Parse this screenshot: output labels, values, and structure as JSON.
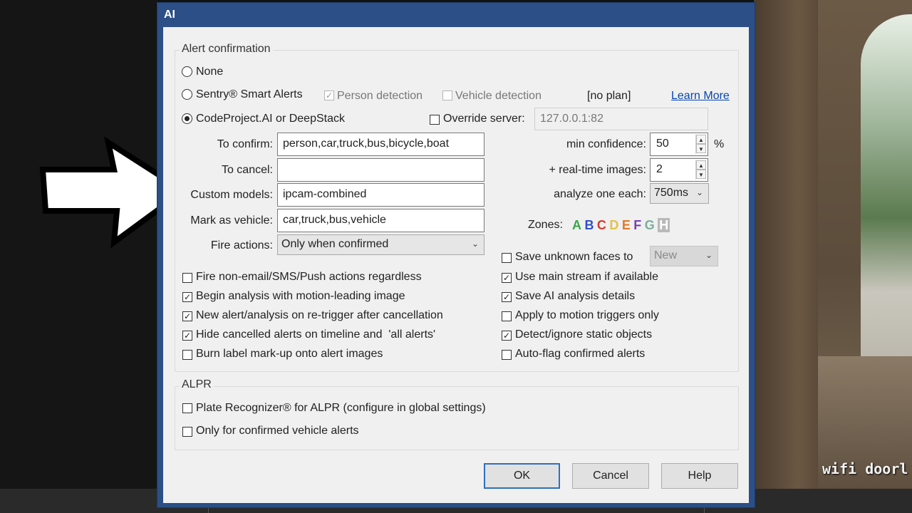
{
  "dialog": {
    "title": "AI"
  },
  "background": {
    "overlay_text": "wifi doorl"
  },
  "alert_confirmation": {
    "group_label": "Alert confirmation",
    "radio_none": "None",
    "radio_sentry": "Sentry® Smart Alerts",
    "person_detection": "Person detection",
    "vehicle_detection": "Vehicle detection",
    "no_plan": "[no plan]",
    "learn_more": "Learn More",
    "radio_codeproject": "CodeProject.AI or DeepStack",
    "override_server_label": "Override server:",
    "override_server_value": "127.0.0.1:82",
    "to_confirm_label": "To confirm:",
    "to_confirm_value": "person,car,truck,bus,bicycle,boat",
    "to_cancel_label": "To cancel:",
    "to_cancel_value": "",
    "custom_models_label": "Custom models:",
    "custom_models_value": "ipcam-combined",
    "mark_vehicle_label": "Mark as vehicle:",
    "mark_vehicle_value": "car,truck,bus,vehicle",
    "fire_actions_label": "Fire actions:",
    "fire_actions_value": "Only when confirmed",
    "min_confidence_label": "min confidence:",
    "min_confidence_value": "50",
    "percent": "%",
    "realtime_images_label": "+ real-time images:",
    "realtime_images_value": "2",
    "analyze_each_label": "analyze one each:",
    "analyze_each_value": "750ms",
    "zones_label": "Zones:",
    "zones": [
      {
        "letter": "A",
        "color": "#3aa845"
      },
      {
        "letter": "B",
        "color": "#2f4fc6"
      },
      {
        "letter": "C",
        "color": "#d43b2f"
      },
      {
        "letter": "D",
        "color": "#e2c24a"
      },
      {
        "letter": "E",
        "color": "#e07a2a"
      },
      {
        "letter": "F",
        "color": "#7a3fb0"
      },
      {
        "letter": "G",
        "color": "#7cae9c"
      },
      {
        "letter": "H",
        "color": "#b9b9b9"
      }
    ],
    "save_unknown_faces_label": "Save unknown faces to",
    "save_unknown_faces_value": "New",
    "left_checks": [
      {
        "label": "Fire non-email/SMS/Push actions regardless",
        "checked": false
      },
      {
        "label": "Begin analysis with motion-leading image",
        "checked": true
      },
      {
        "label": "New alert/analysis on re-trigger after cancellation",
        "checked": true
      },
      {
        "label": "Hide cancelled alerts on timeline and  'all alerts'",
        "checked": true
      },
      {
        "label": "Burn label mark-up onto alert images",
        "checked": false
      }
    ],
    "right_checks": [
      {
        "label": "Use main stream if available",
        "checked": true
      },
      {
        "label": "Save AI analysis details",
        "checked": true
      },
      {
        "label": "Apply to motion triggers only",
        "checked": false
      },
      {
        "label": "Detect/ignore static objects",
        "checked": true
      },
      {
        "label": "Auto-flag confirmed alerts",
        "checked": false
      }
    ],
    "check_mark": "✓"
  },
  "alpr": {
    "group_label": "ALPR",
    "plate_recognizer": "Plate Recognizer® for ALPR (configure in global settings)",
    "only_confirmed_vehicle": "Only for confirmed vehicle alerts"
  },
  "buttons": {
    "ok": "OK",
    "cancel": "Cancel",
    "help": "Help"
  }
}
